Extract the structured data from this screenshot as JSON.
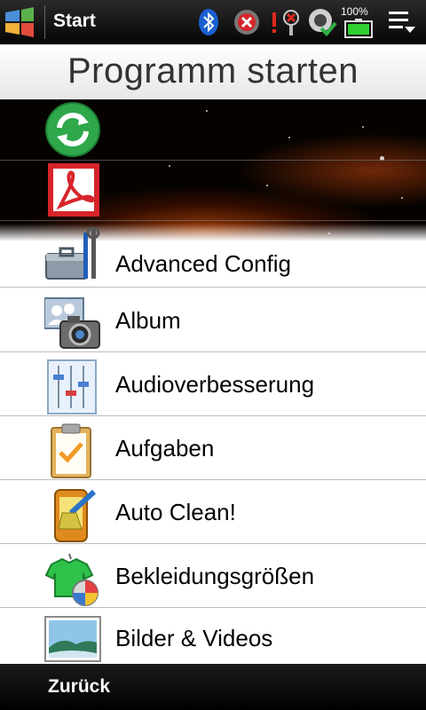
{
  "statusbar": {
    "title": "Start",
    "battery_text": "100%",
    "icons": [
      "windows-start-icon",
      "bluetooth-icon",
      "no-signal-icon",
      "notification-icon",
      "sync-icon",
      "battery-icon",
      "menu-icon"
    ]
  },
  "header": {
    "title": "Programm starten"
  },
  "list": {
    "items": [
      {
        "label": "",
        "icon": "refresh-icon"
      },
      {
        "label": "",
        "icon": "adobe-reader-icon"
      },
      {
        "label": "Advanced Config",
        "icon": "toolbox-icon"
      },
      {
        "label": "Album",
        "icon": "camera-album-icon"
      },
      {
        "label": "Audioverbesserung",
        "icon": "equalizer-icon"
      },
      {
        "label": "Aufgaben",
        "icon": "clipboard-icon"
      },
      {
        "label": "Auto Clean!",
        "icon": "broom-icon"
      },
      {
        "label": "Bekleidungsgrößen",
        "icon": "shirt-icon"
      },
      {
        "label": "Bilder & Videos",
        "icon": "landscape-picture-icon"
      }
    ]
  },
  "softkeys": {
    "left": "Zurück"
  },
  "colors": {
    "statusbar": "#050505",
    "accent_green": "#2ea84a",
    "adobe_red": "#d7242a"
  }
}
